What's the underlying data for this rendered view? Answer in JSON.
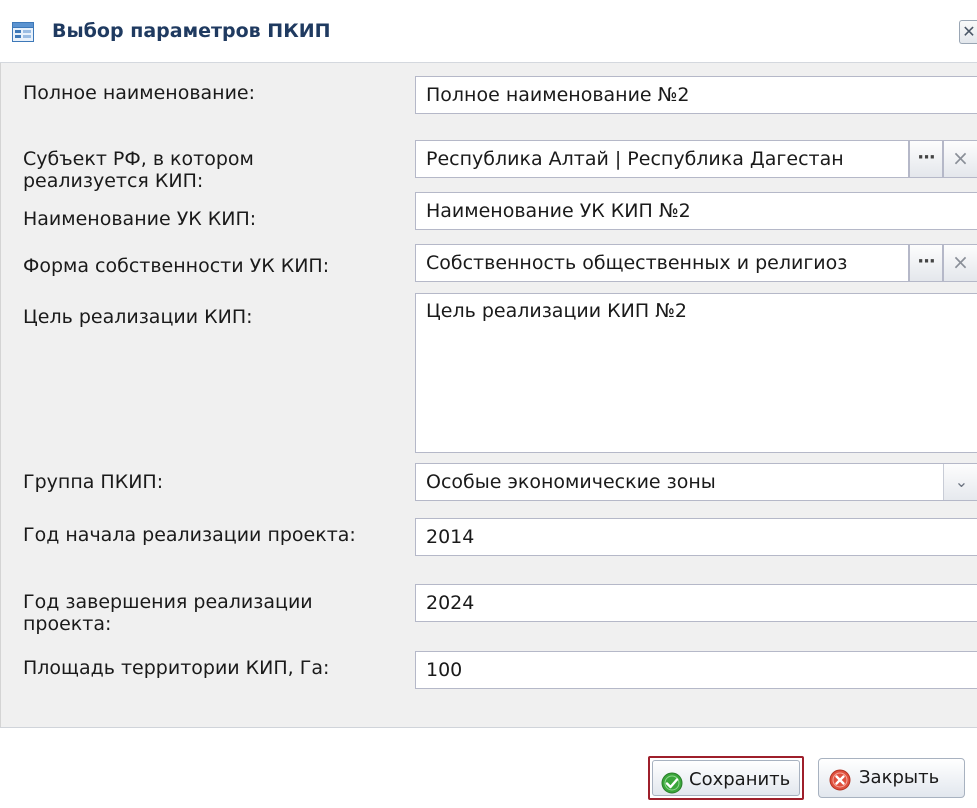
{
  "window": {
    "title": "Выбор параметров ПКИП",
    "close_glyph": "✕"
  },
  "form": {
    "full_name": {
      "label": "Полное наименование:",
      "value": "Полное наименование №2"
    },
    "subject_rf": {
      "label": "Субъект РФ, в котором реализуется КИП:",
      "value": "Республика Алтай | Республика Дагестан",
      "select_glyph": "···",
      "clear_glyph": "×"
    },
    "uk_name": {
      "label": "Наименование УК КИП:",
      "value": "Наименование УК КИП №2"
    },
    "ownership": {
      "label": "Форма собственности УК КИП:",
      "value": "Собственность общественных и религиоз",
      "select_glyph": "···",
      "clear_glyph": "×"
    },
    "goal": {
      "label": "Цель реализации КИП:",
      "value": "Цель реализации КИП №2"
    },
    "group": {
      "label": "Группа ПКИП:",
      "value": "Особые экономические зоны",
      "arrow_glyph": "⌄"
    },
    "start_year": {
      "label": "Год начала реализации проекта:",
      "value": "2014"
    },
    "end_year": {
      "label": "Год завершения реализации проекта:",
      "value": "2024"
    },
    "area": {
      "label": "Площадь территории КИП, Га:",
      "value": "100"
    }
  },
  "footer": {
    "save_label": "Сохранить",
    "close_label": "Закрыть"
  },
  "icons": {
    "title_icon": "form-table-icon",
    "save_icon": "check-circle-icon",
    "close_icon": "cancel-circle-icon"
  },
  "colors": {
    "title_text": "#1f3a60",
    "panel_bg": "#f0f0f0",
    "save_highlight": "#9e1f2b",
    "save_icon": "#3aa63a",
    "close_icon": "#e0503e"
  }
}
